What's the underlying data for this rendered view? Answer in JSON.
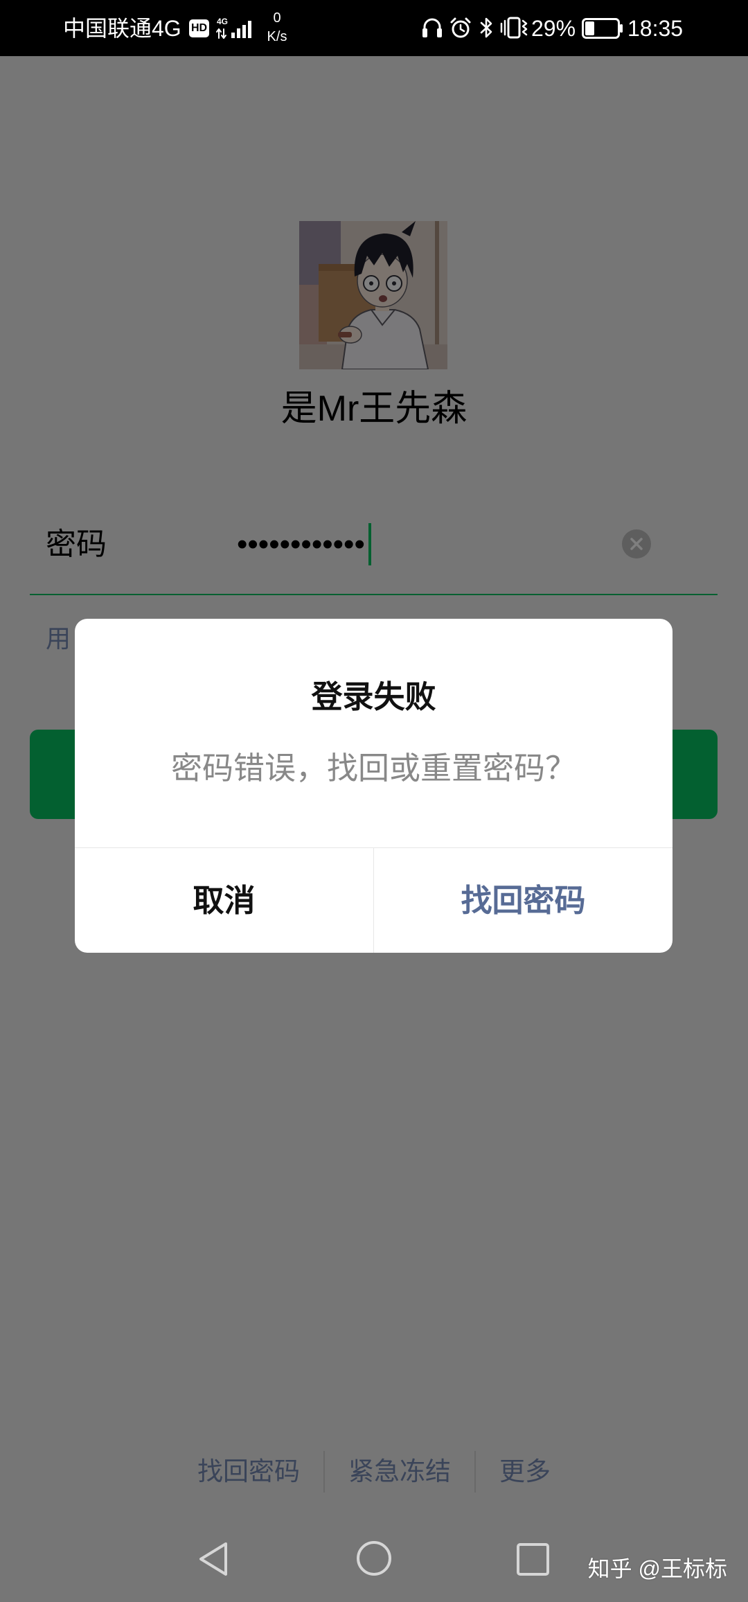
{
  "status_bar": {
    "carrier": "中国联通4G",
    "hd_badge": "HD",
    "network_type": "4G",
    "net_speed_value": "0",
    "net_speed_unit": "K/s",
    "battery_text": "29%",
    "battery_level": 0.29,
    "time": "18:35",
    "icons": [
      "hd-icon",
      "signal-icon",
      "headset-icon",
      "alarm-icon",
      "bluetooth-icon",
      "vibrate-icon",
      "battery-icon"
    ]
  },
  "profile": {
    "name": "是Mr王先森",
    "avatar_icon": "avatar-image"
  },
  "login_form": {
    "password_label": "密码",
    "password_mask": "••••••••••••",
    "alt_login_link_visible_text": "用",
    "clear_icon": "clear-circle-icon"
  },
  "dialog": {
    "title": "登录失败",
    "message": "密码错误，找回或重置密码？",
    "cancel_label": "取消",
    "confirm_label": "找回密码"
  },
  "footer_links": [
    {
      "label": "找回密码"
    },
    {
      "label": "紧急冻结"
    },
    {
      "label": "更多"
    }
  ],
  "nav_bar": {
    "icons": [
      "back-icon",
      "home-icon",
      "recents-icon"
    ]
  },
  "watermark": "知乎 @王标标",
  "colors": {
    "accent_green": "#07c160",
    "link_blue": "#576b95",
    "page_bg": "#ededed",
    "scrim": "rgba(0,0,0,0.5)",
    "dialog_bg": "#ffffff",
    "dialog_message": "#888888",
    "nav_icon": "#d6d6d6"
  }
}
